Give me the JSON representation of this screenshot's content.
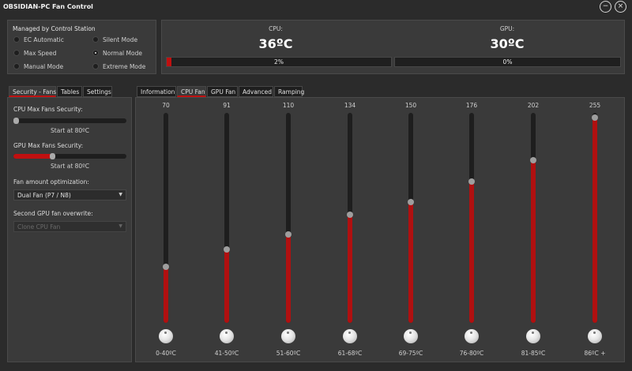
{
  "window": {
    "title": "OBSIDIAN-PC Fan Control"
  },
  "mode_panel": {
    "title": "Managed by Control Station",
    "modes": [
      {
        "label": "EC Automatic",
        "checked": false
      },
      {
        "label": "Silent Mode",
        "checked": false
      },
      {
        "label": "Max Speed",
        "checked": false
      },
      {
        "label": "Normal Mode",
        "checked": true
      },
      {
        "label": "Manual Mode",
        "checked": false
      },
      {
        "label": "Extreme Mode",
        "checked": false
      }
    ]
  },
  "cpu": {
    "label": "CPU:",
    "temp": "36ºC",
    "load_text": "2%",
    "load": 0.02
  },
  "gpu": {
    "label": "GPU:",
    "temp": "30ºC",
    "load_text": "0%",
    "load": 0.0
  },
  "left_tabs": [
    {
      "label": "Security - Fans",
      "active": true
    },
    {
      "label": "Tables",
      "active": false
    },
    {
      "label": "Settings",
      "active": false
    }
  ],
  "security": {
    "cpu_label": "CPU Max Fans Security:",
    "cpu_value": 0.0,
    "cpu_hint": "Start at 80ºC",
    "gpu_label": "GPU Max Fans Security:",
    "gpu_value": 0.34,
    "gpu_hint": "Start at 80ºC",
    "fan_amount_label": "Fan amount optimization:",
    "fan_amount_value": "Dual Fan (P7 / N8)",
    "second_gpu_label": "Second GPU fan overwrite:",
    "second_gpu_value": "Clone CPU Fan"
  },
  "right_tabs": [
    {
      "label": "Information",
      "active": false
    },
    {
      "label": "CPU Fan",
      "active": true
    },
    {
      "label": "GPU Fan",
      "active": false
    },
    {
      "label": "Advanced",
      "active": false
    },
    {
      "label": "Ramping",
      "active": false
    }
  ],
  "fan_curve": {
    "max": 255,
    "points": [
      {
        "value": "70",
        "range": "0-40ºC"
      },
      {
        "value": "91",
        "range": "41-50ºC"
      },
      {
        "value": "110",
        "range": "51-60ºC"
      },
      {
        "value": "134",
        "range": "61-68ºC"
      },
      {
        "value": "150",
        "range": "69-75ºC"
      },
      {
        "value": "176",
        "range": "76-80ºC"
      },
      {
        "value": "202",
        "range": "81-85ºC"
      },
      {
        "value": "255",
        "range": "86ºC +"
      }
    ]
  }
}
